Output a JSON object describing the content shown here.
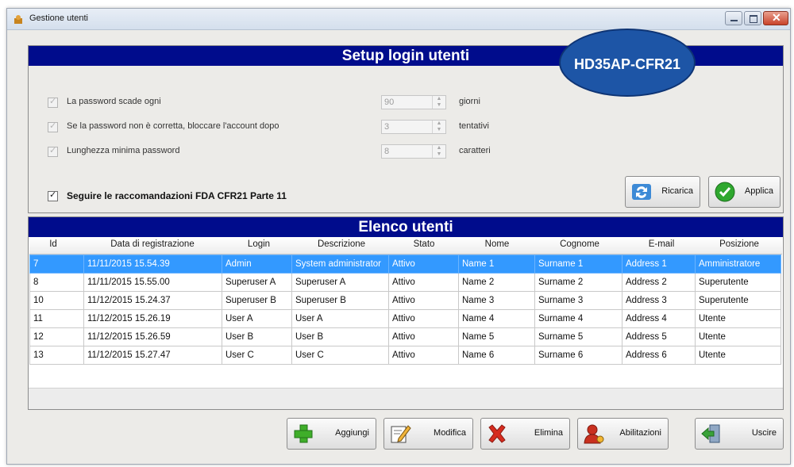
{
  "window": {
    "title": "Gestione utenti",
    "close_glyph": "✕"
  },
  "setup": {
    "header": "Setup login utenti",
    "badge": "HD35AP-CFR21",
    "settings": [
      {
        "label": "La password scade ogni",
        "value": "90",
        "unit": "giorni",
        "checked": true
      },
      {
        "label": "Se la password non è corretta, bloccare l'account dopo",
        "value": "3",
        "unit": "tentativi",
        "checked": true
      },
      {
        "label": "Lunghezza minima password",
        "value": "8",
        "unit": "caratteri",
        "checked": true
      }
    ],
    "fda_label": "Seguire le raccomandazioni FDA CFR21 Parte 11",
    "fda_checked": true,
    "reload_label": "Ricarica",
    "apply_label": "Applica"
  },
  "users": {
    "header": "Elenco utenti",
    "columns": [
      "Id",
      "Data di registrazione",
      "Login",
      "Descrizione",
      "Stato",
      "Nome",
      "Cognome",
      "E-mail",
      "Posizione"
    ],
    "rows": [
      [
        "7",
        "11/11/2015 15.54.39",
        "Admin",
        "System administrator",
        "Attivo",
        "Name 1",
        "Surname 1",
        "Address 1",
        "Amministratore"
      ],
      [
        "8",
        "11/11/2015 15.55.00",
        "Superuser A",
        "Superuser A",
        "Attivo",
        "Name 2",
        "Surname 2",
        "Address 2",
        "Superutente"
      ],
      [
        "10",
        "11/12/2015 15.24.37",
        "Superuser B",
        "Superuser B",
        "Attivo",
        "Name 3",
        "Surname 3",
        "Address 3",
        "Superutente"
      ],
      [
        "11",
        "11/12/2015 15.26.19",
        "User A",
        "User A",
        "Attivo",
        "Name 4",
        "Surname 4",
        "Address 4",
        "Utente"
      ],
      [
        "12",
        "11/12/2015 15.26.59",
        "User B",
        "User B",
        "Attivo",
        "Name 5",
        "Surname 5",
        "Address 5",
        "Utente"
      ],
      [
        "13",
        "11/12/2015 15.27.47",
        "User C",
        "User C",
        "Attivo",
        "Name 6",
        "Surname 6",
        "Address 6",
        "Utente"
      ]
    ],
    "selected_row": 0
  },
  "actions": {
    "add_label": "Aggiungi",
    "edit_label": "Modifica",
    "delete_label": "Elimina",
    "permissions_label": "Abilitazioni",
    "exit_label": "Uscire"
  },
  "icons": [
    "app-icon",
    "minimize-icon",
    "maximize-icon",
    "close-icon",
    "reload-icon",
    "apply-check-icon",
    "add-plus-icon",
    "edit-pencil-icon",
    "delete-x-icon",
    "user-permissions-icon",
    "exit-door-icon"
  ],
  "colors": {
    "header_bg": "#000c8c",
    "badge_bg": "#1d55a6",
    "selection": "#3399ff",
    "apply_green": "#2fa82f",
    "delete_red": "#d62b1e"
  }
}
